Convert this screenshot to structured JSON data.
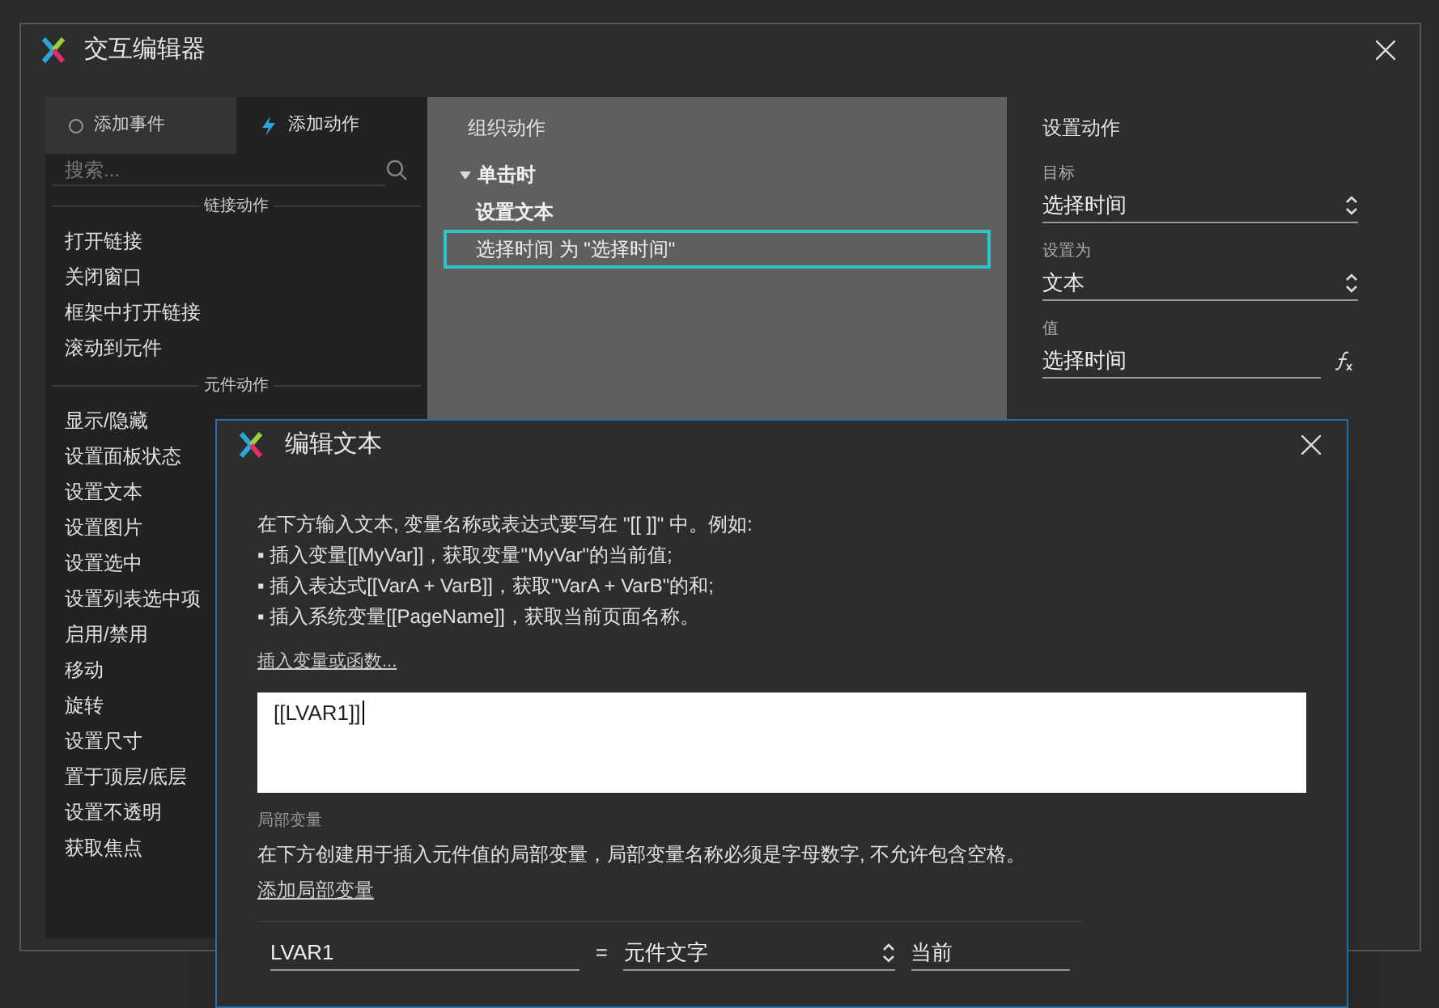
{
  "window": {
    "title": "交互编辑器"
  },
  "tabs": [
    {
      "label": "添加事件",
      "selected": false
    },
    {
      "label": "添加动作",
      "selected": true
    }
  ],
  "search": {
    "placeholder": "搜索..."
  },
  "action_groups": [
    {
      "title": "链接动作",
      "items": [
        "打开链接",
        "关闭窗口",
        "框架中打开链接",
        "滚动到元件"
      ]
    },
    {
      "title": "元件动作",
      "items": [
        "显示/隐藏",
        "设置面板状态",
        "设置文本",
        "设置图片",
        "设置选中",
        "设置列表选中项",
        "启用/禁用",
        "移动",
        "旋转",
        "设置尺寸",
        "置于顶层/底层",
        "设置不透明",
        "获取焦点"
      ]
    }
  ],
  "organize": {
    "title": "组织动作",
    "events": [
      {
        "label": "单击时",
        "expanded": true,
        "actions": [
          {
            "name": "设置文本",
            "detail": "选择时间 为 \"选择时间\"",
            "selected": true
          }
        ]
      }
    ]
  },
  "settings": {
    "title": "设置动作",
    "fields": [
      {
        "label": "目标",
        "value": "选择时间",
        "kind": "select"
      },
      {
        "label": "设置为",
        "value": "文本",
        "kind": "select"
      },
      {
        "label": "值",
        "value": "选择时间",
        "kind": "formula"
      }
    ]
  },
  "edit_dialog": {
    "title": "编辑文本",
    "instructions": [
      "在下方输入文本, 变量名称或表达式要写在 \"[[ ]]\" 中。例如:",
      "▪ 插入变量[[MyVar]]，获取变量\"MyVar\"的当前值;",
      "▪ 插入表达式[[VarA + VarB]]，获取\"VarA + VarB\"的和;",
      "▪ 插入系统变量[[PageName]]，获取当前页面名称。"
    ],
    "insert_link": "插入变量或函数...",
    "text_value": "[[LVAR1]]",
    "local_title": "局部变量",
    "local_desc": "在下方创建用于插入元件值的局部变量，局部变量名称必须是字母数字, 不允许包含空格。",
    "add_link": "添加局部变量",
    "variables": [
      {
        "name": "LVAR1",
        "equals": "=",
        "type": "元件文字",
        "target": "当前"
      }
    ]
  }
}
